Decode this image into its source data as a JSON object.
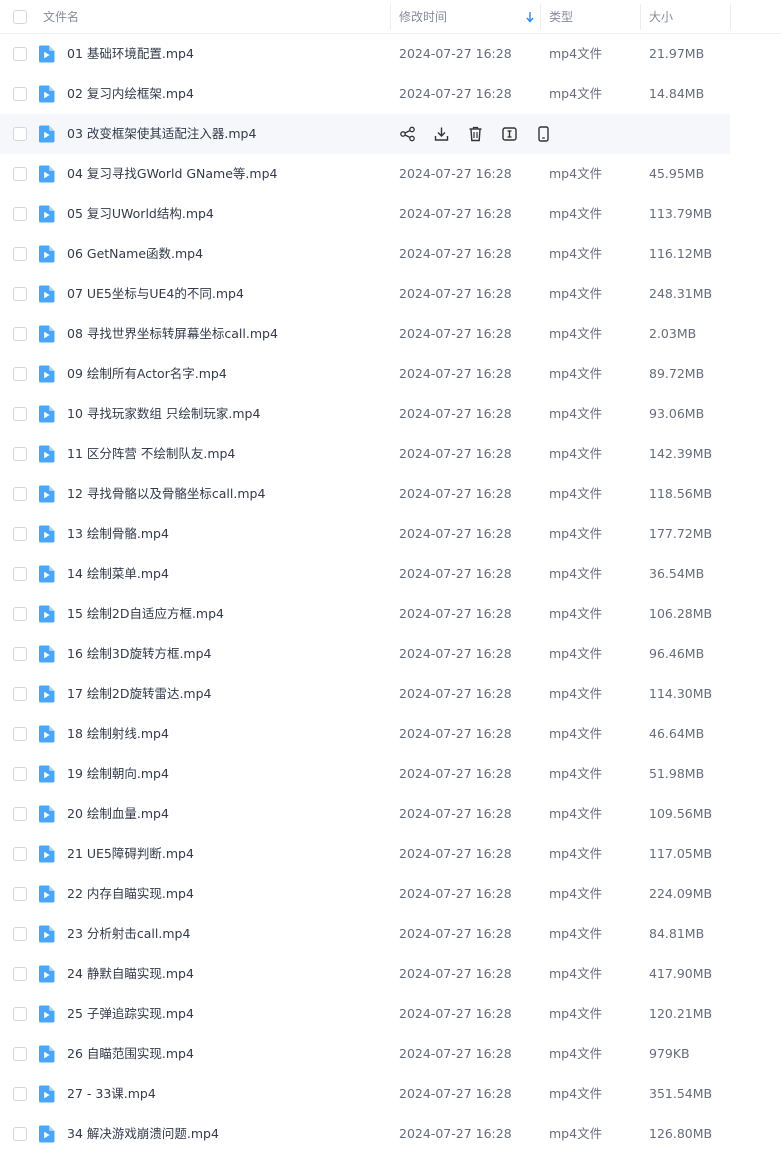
{
  "header": {
    "name_label": "文件名",
    "time_label": "修改时间",
    "type_label": "类型",
    "size_label": "大小"
  },
  "colors": {
    "file_icon": "#4ba7f5",
    "header_text": "#878c9c",
    "row_hover": "#f5f7fa",
    "sort_arrow": "#2a8cf0"
  },
  "icons": {
    "row_actions": [
      "share-icon",
      "download-icon",
      "delete-icon",
      "rename-icon",
      "phone-icon"
    ]
  },
  "files": [
    {
      "name": "01 基础环境配置.mp4",
      "time": "2024-07-27 16:28",
      "type": "mp4文件",
      "size": "21.97MB"
    },
    {
      "name": "02 复习内绘框架.mp4",
      "time": "2024-07-27 16:28",
      "type": "mp4文件",
      "size": "14.84MB"
    },
    {
      "name": "03 改变框架使其适配注入器.mp4",
      "time": "",
      "type": "",
      "size": "",
      "hovered": true
    },
    {
      "name": "04 复习寻找GWorld GName等.mp4",
      "time": "2024-07-27 16:28",
      "type": "mp4文件",
      "size": "45.95MB"
    },
    {
      "name": "05 复习UWorld结构.mp4",
      "time": "2024-07-27 16:28",
      "type": "mp4文件",
      "size": "113.79MB"
    },
    {
      "name": "06 GetName函数.mp4",
      "time": "2024-07-27 16:28",
      "type": "mp4文件",
      "size": "116.12MB"
    },
    {
      "name": "07 UE5坐标与UE4的不同.mp4",
      "time": "2024-07-27 16:28",
      "type": "mp4文件",
      "size": "248.31MB"
    },
    {
      "name": "08 寻找世界坐标转屏幕坐标call.mp4",
      "time": "2024-07-27 16:28",
      "type": "mp4文件",
      "size": "2.03MB"
    },
    {
      "name": "09 绘制所有Actor名字.mp4",
      "time": "2024-07-27 16:28",
      "type": "mp4文件",
      "size": "89.72MB"
    },
    {
      "name": "10 寻找玩家数组 只绘制玩家.mp4",
      "time": "2024-07-27 16:28",
      "type": "mp4文件",
      "size": "93.06MB"
    },
    {
      "name": "11 区分阵营 不绘制队友.mp4",
      "time": "2024-07-27 16:28",
      "type": "mp4文件",
      "size": "142.39MB"
    },
    {
      "name": "12 寻找骨骼以及骨骼坐标call.mp4",
      "time": "2024-07-27 16:28",
      "type": "mp4文件",
      "size": "118.56MB"
    },
    {
      "name": "13 绘制骨骼.mp4",
      "time": "2024-07-27 16:28",
      "type": "mp4文件",
      "size": "177.72MB"
    },
    {
      "name": "14 绘制菜单.mp4",
      "time": "2024-07-27 16:28",
      "type": "mp4文件",
      "size": "36.54MB"
    },
    {
      "name": "15 绘制2D自适应方框.mp4",
      "time": "2024-07-27 16:28",
      "type": "mp4文件",
      "size": "106.28MB"
    },
    {
      "name": "16 绘制3D旋转方框.mp4",
      "time": "2024-07-27 16:28",
      "type": "mp4文件",
      "size": "96.46MB"
    },
    {
      "name": "17 绘制2D旋转雷达.mp4",
      "time": "2024-07-27 16:28",
      "type": "mp4文件",
      "size": "114.30MB"
    },
    {
      "name": "18 绘制射线.mp4",
      "time": "2024-07-27 16:28",
      "type": "mp4文件",
      "size": "46.64MB"
    },
    {
      "name": "19 绘制朝向.mp4",
      "time": "2024-07-27 16:28",
      "type": "mp4文件",
      "size": "51.98MB"
    },
    {
      "name": "20 绘制血量.mp4",
      "time": "2024-07-27 16:28",
      "type": "mp4文件",
      "size": "109.56MB"
    },
    {
      "name": "21 UE5障碍判断.mp4",
      "time": "2024-07-27 16:28",
      "type": "mp4文件",
      "size": "117.05MB"
    },
    {
      "name": "22 内存自瞄实现.mp4",
      "time": "2024-07-27 16:28",
      "type": "mp4文件",
      "size": "224.09MB"
    },
    {
      "name": "23 分析射击call.mp4",
      "time": "2024-07-27 16:28",
      "type": "mp4文件",
      "size": "84.81MB"
    },
    {
      "name": "24 静默自瞄实现.mp4",
      "time": "2024-07-27 16:28",
      "type": "mp4文件",
      "size": "417.90MB"
    },
    {
      "name": "25 子弹追踪实现.mp4",
      "time": "2024-07-27 16:28",
      "type": "mp4文件",
      "size": "120.21MB"
    },
    {
      "name": "26 自瞄范围实现.mp4",
      "time": "2024-07-27 16:28",
      "type": "mp4文件",
      "size": "979KB"
    },
    {
      "name": "27 - 33课.mp4",
      "time": "2024-07-27 16:28",
      "type": "mp4文件",
      "size": "351.54MB"
    },
    {
      "name": "34 解决游戏崩溃问题.mp4",
      "time": "2024-07-27 16:28",
      "type": "mp4文件",
      "size": "126.80MB"
    }
  ]
}
